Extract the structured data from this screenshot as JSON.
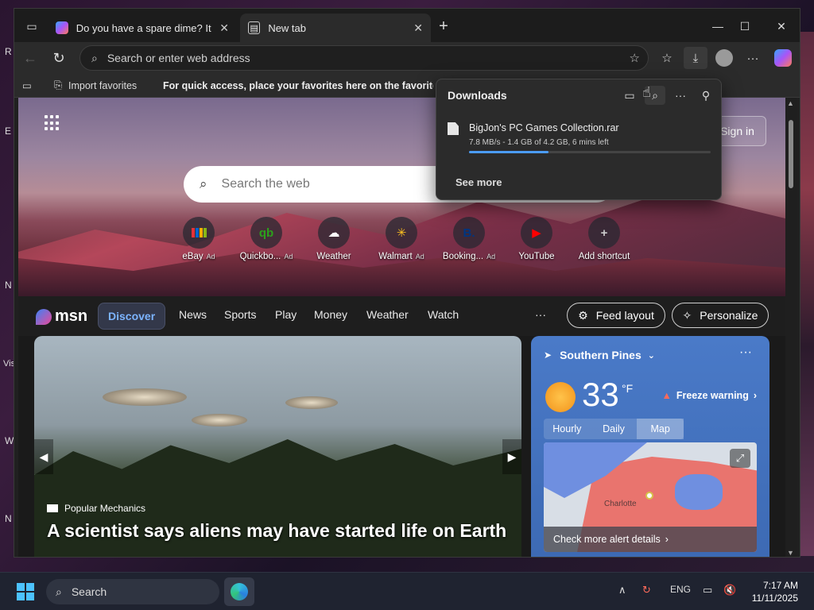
{
  "desktop": {
    "edge_letters": [
      "R",
      "E",
      "N",
      "Vis",
      "W",
      "N"
    ]
  },
  "tabs": [
    {
      "title": "Do you have a spare dime? It cou",
      "active": false
    },
    {
      "title": "New tab",
      "active": true
    }
  ],
  "address_bar": {
    "placeholder": "Search or enter web address"
  },
  "favorites_bar": {
    "import_label": "Import favorites",
    "hint": "For quick access, place your favorites here on the favorites b"
  },
  "downloads": {
    "title": "Downloads",
    "file_name": "BigJon's PC Games Collection.rar",
    "progress_text": "7.8 MB/s - 1.4 GB of 4.2 GB, 6 mins left",
    "progress_fraction": 0.33,
    "see_more": "See more"
  },
  "new_tab": {
    "sign_in": "Sign in",
    "search_placeholder": "Search the web",
    "shortcuts": [
      {
        "label": "eBay",
        "ad": "Ad",
        "glyph": "",
        "color": "#e53238"
      },
      {
        "label": "Quickbo...",
        "ad": "Ad",
        "glyph": "qb",
        "color": "#2ca01c"
      },
      {
        "label": "Weather",
        "ad": "",
        "glyph": "☁",
        "color": "#ffffff"
      },
      {
        "label": "Walmart",
        "ad": "Ad",
        "glyph": "✳",
        "color": "#ffc220"
      },
      {
        "label": "Booking...",
        "ad": "Ad",
        "glyph": "B.",
        "color": "#003580"
      },
      {
        "label": "YouTube",
        "ad": "",
        "glyph": "▶",
        "color": "#ff0000"
      },
      {
        "label": "Add shortcut",
        "ad": "",
        "glyph": "+",
        "color": "#cccccc"
      }
    ]
  },
  "msn": {
    "logo": "msn",
    "nav": [
      "Discover",
      "News",
      "Sports",
      "Play",
      "Money",
      "Weather",
      "Watch"
    ],
    "more": "···",
    "feed_layout": "Feed layout",
    "personalize": "Personalize"
  },
  "story": {
    "source": "Popular Mechanics",
    "headline": "A scientist says aliens may have started life on Earth"
  },
  "weather": {
    "location": "Southern Pines",
    "more": "···",
    "temp": "33",
    "unit": "°F",
    "warning": "Freeze warning",
    "tabs": [
      "Hourly",
      "Daily",
      "Map"
    ],
    "selected_tab": "Map",
    "map_city": "Charlotte",
    "alert_link": "Check more alert details"
  },
  "taskbar": {
    "search_label": "Search",
    "language": "ENG",
    "time": "7:17 AM",
    "date": "11/11/2025"
  },
  "colors": {
    "accent": "#4b9cf7",
    "active_nav": "#7cb4ff",
    "weather_bg": "#4a7ac8"
  }
}
